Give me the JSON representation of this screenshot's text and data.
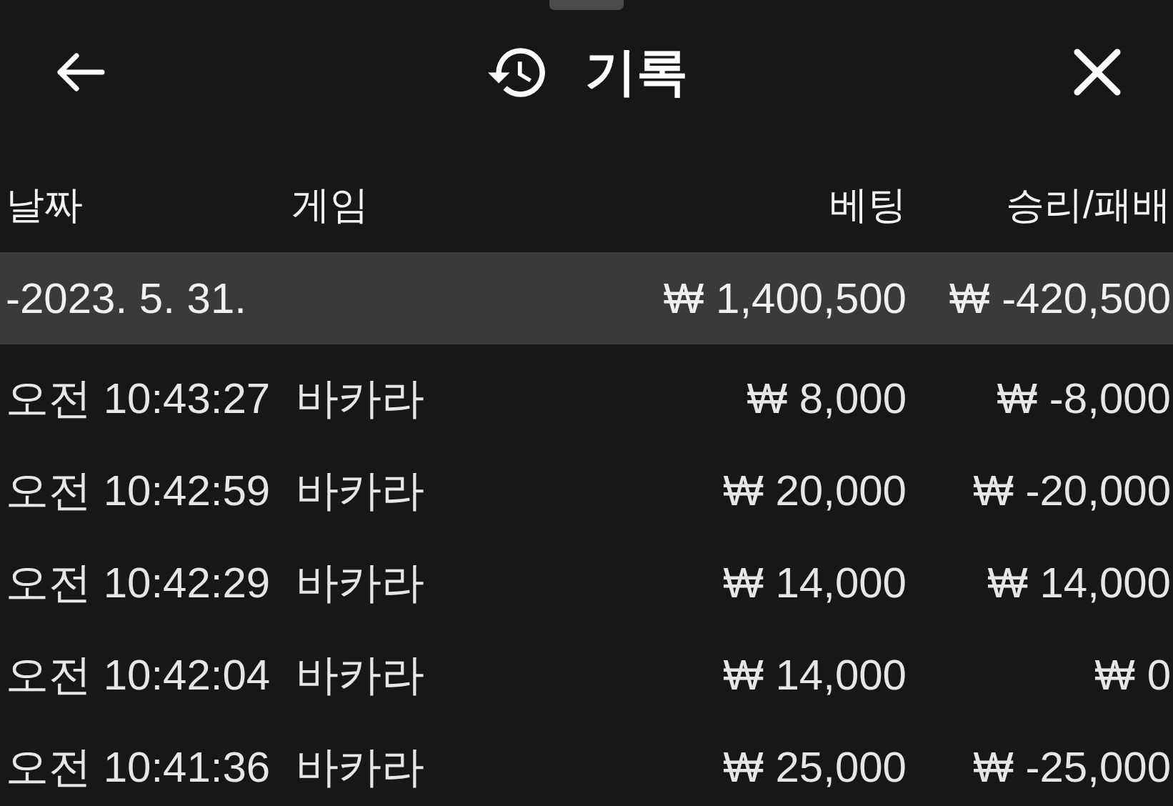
{
  "header": {
    "title": "기록"
  },
  "table": {
    "columns": [
      "날짜",
      "게임",
      "베팅",
      "승리/패배"
    ],
    "groups": [
      {
        "date": "-2023. 5. 31.",
        "bet_total": "₩ 1,400,500",
        "result_total": "₩ -420,500",
        "rows": [
          {
            "time": "오전 10:43:27",
            "game": "바카라",
            "bet": "₩ 8,000",
            "result": "₩ -8,000"
          },
          {
            "time": "오전 10:42:59",
            "game": "바카라",
            "bet": "₩ 20,000",
            "result": "₩ -20,000"
          },
          {
            "time": "오전 10:42:29",
            "game": "바카라",
            "bet": "₩ 14,000",
            "result": "₩ 14,000"
          },
          {
            "time": "오전 10:42:04",
            "game": "바카라",
            "bet": "₩ 14,000",
            "result": "₩ 0"
          },
          {
            "time": "오전 10:41:36",
            "game": "바카라",
            "bet": "₩ 25,000",
            "result": "₩ -25,000"
          }
        ]
      }
    ]
  }
}
